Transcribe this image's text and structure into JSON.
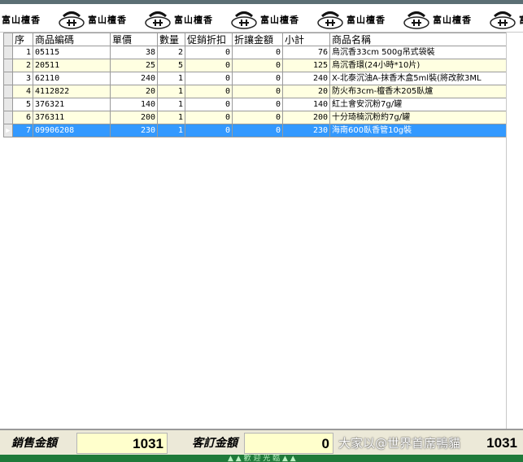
{
  "banner": {
    "brand_text": "富山檀香",
    "tile_count": 7
  },
  "grid": {
    "columns": [
      "序",
      "商品編碼",
      "單價",
      "數量",
      "促銷折扣",
      "折讓金額",
      "小計",
      "商品名稱"
    ],
    "rows": [
      {
        "seq": "1",
        "code": "05115",
        "price": "38",
        "qty": "2",
        "promo": "0",
        "allow": "0",
        "subtotal": "76",
        "name": "烏沉香33cm 500g吊式袋裝"
      },
      {
        "seq": "2",
        "code": "20511",
        "price": "25",
        "qty": "5",
        "promo": "0",
        "allow": "0",
        "subtotal": "125",
        "name": "烏沉香環(24小時*10片)"
      },
      {
        "seq": "3",
        "code": "62110",
        "price": "240",
        "qty": "1",
        "promo": "0",
        "allow": "0",
        "subtotal": "240",
        "name": "X-北泰沉油A-抹香木盒5ml裝(將改款3ML"
      },
      {
        "seq": "4",
        "code": "4112822",
        "price": "20",
        "qty": "1",
        "promo": "0",
        "allow": "0",
        "subtotal": "20",
        "name": "防火布3cm-檀香木205臥爐"
      },
      {
        "seq": "5",
        "code": "376321",
        "price": "140",
        "qty": "1",
        "promo": "0",
        "allow": "0",
        "subtotal": "140",
        "name": "紅土會安沉粉7g/罐"
      },
      {
        "seq": "6",
        "code": "376311",
        "price": "200",
        "qty": "1",
        "promo": "0",
        "allow": "0",
        "subtotal": "200",
        "name": "十分琦楠沉粉約7g/罐"
      },
      {
        "seq": "7",
        "code": "09906208",
        "price": "230",
        "qty": "1",
        "promo": "0",
        "allow": "0",
        "subtotal": "230",
        "name": "海南600臥香管10g裝"
      }
    ],
    "selected_index": 6,
    "row_indicator": "▶"
  },
  "totals": {
    "sales_label": "銷售金額",
    "sales_value": "1031",
    "order_label": "客訂金額",
    "order_value": "0",
    "watermark": "大家以@世界首席鴨貓",
    "right_value": "1031"
  },
  "statusbar": {
    "text": "▲ ▲ 歡 迎 光 臨 ▲ ▲"
  },
  "colors": {
    "selected_row": "#3399ff",
    "alt_row": "#ffffe1",
    "value_box": "#ffffcc",
    "statusbar": "#1f7a3a"
  }
}
